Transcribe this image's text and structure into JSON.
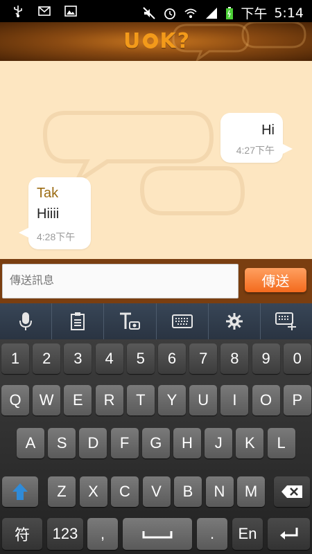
{
  "status_bar": {
    "time": "5:14",
    "ampm": "下午"
  },
  "app": {
    "logo_left": "U",
    "logo_right": "K?"
  },
  "messages": [
    {
      "direction": "out",
      "text": "Hi",
      "time": "4:27下午"
    },
    {
      "direction": "in",
      "sender": "Tak",
      "text": "Hiiii",
      "time": "4:28下午"
    }
  ],
  "compose": {
    "placeholder": "傳送訊息",
    "value": "",
    "send_label": "傳送"
  },
  "keyboard": {
    "toolbar": [
      "mic-icon",
      "clipboard-icon",
      "text-camera-icon",
      "keyboard-icon",
      "gear-icon",
      "keyboard-layout-icon"
    ],
    "row_numbers": [
      "1",
      "2",
      "3",
      "4",
      "5",
      "6",
      "7",
      "8",
      "9",
      "0"
    ],
    "row1": [
      "Q",
      "W",
      "E",
      "R",
      "T",
      "Y",
      "U",
      "I",
      "O",
      "P"
    ],
    "row2": [
      "A",
      "S",
      "D",
      "F",
      "G",
      "H",
      "J",
      "K",
      "L"
    ],
    "row3": [
      "Z",
      "X",
      "C",
      "V",
      "B",
      "N",
      "M"
    ],
    "symbols_label": "符",
    "num_label": "123",
    "comma_label": ",",
    "period_label": ".",
    "lang_label": "En",
    "colors": {
      "accent": "#f39a1a",
      "send": "#f36a1d",
      "shift": "#2f8bd8"
    }
  }
}
